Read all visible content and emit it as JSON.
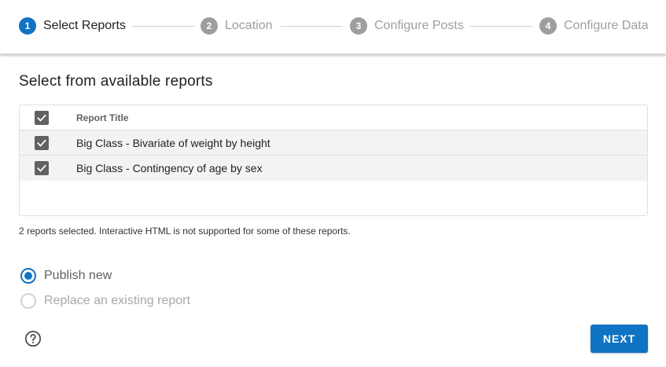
{
  "stepper": {
    "steps": [
      {
        "number": "1",
        "label": "Select Reports",
        "state": "active"
      },
      {
        "number": "2",
        "label": "Location",
        "state": "inactive"
      },
      {
        "number": "3",
        "label": "Configure Posts",
        "state": "inactive"
      },
      {
        "number": "4",
        "label": "Configure Data",
        "state": "inactive"
      }
    ]
  },
  "main": {
    "title": "Select from available reports",
    "table": {
      "header": {
        "title": "Report Title",
        "checked": true
      },
      "rows": [
        {
          "title": "Big Class - Bivariate of weight by height",
          "checked": true
        },
        {
          "title": "Big Class - Contingency of age by sex",
          "checked": true
        }
      ]
    },
    "status": "2 reports selected. Interactive HTML is not supported for some of these reports.",
    "publish_options": [
      {
        "label": "Publish new",
        "selected": true,
        "enabled": true
      },
      {
        "label": "Replace an existing report",
        "selected": false,
        "enabled": false
      }
    ]
  },
  "footer": {
    "help_icon": "help-circle-icon",
    "next_label": "NEXT"
  },
  "colors": {
    "accent": "#1173c4",
    "inactive_step": "#9e9e9e",
    "checkbox": "#616161"
  }
}
